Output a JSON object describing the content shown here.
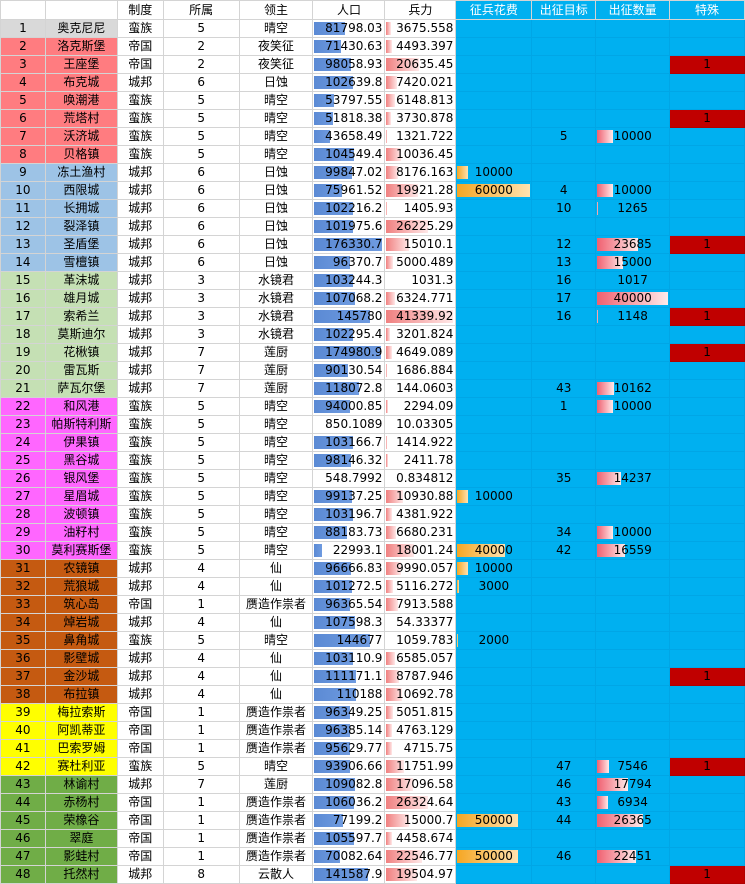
{
  "headers": [
    "",
    "",
    "制度",
    "所属",
    "领主",
    "人口",
    "兵力",
    "征兵花费",
    "出征目标",
    "出征数量",
    "特殊"
  ],
  "colors": {
    "salmon": "#ff7c80",
    "lightblue": "#9dc3e6",
    "lightgreen": "#c5e0b4",
    "magenta": "#ff66ff",
    "orange": "#c55a11",
    "yellow": "#ffff00",
    "green": "#70ad47",
    "gray": "#d9d9d9",
    "blue": "#00b0f0",
    "red": "#c00000"
  },
  "rows": [
    {
      "n": "1",
      "name": "奥克尼尼",
      "sys": "蛮族",
      "belong": "5",
      "lord": "晴空",
      "pop": "81798.03",
      "str": "3675.558",
      "cost": "",
      "target": "",
      "count": "",
      "special": "",
      "grp": "gray"
    },
    {
      "n": "2",
      "name": "洛克斯堡",
      "sys": "帝国",
      "belong": "2",
      "lord": "夜笑征",
      "pop": "71430.63",
      "str": "4493.397",
      "cost": "",
      "target": "",
      "count": "",
      "special": "",
      "grp": "salmon"
    },
    {
      "n": "3",
      "name": "王座堡",
      "sys": "帝国",
      "belong": "2",
      "lord": "夜笑征",
      "pop": "98058.93",
      "str": "20635.45",
      "cost": "",
      "target": "",
      "count": "",
      "special": "1",
      "grp": "salmon"
    },
    {
      "n": "4",
      "name": "布克城",
      "sys": "城邦",
      "belong": "6",
      "lord": "日蚀",
      "pop": "102639.8",
      "str": "7420.021",
      "cost": "",
      "target": "",
      "count": "",
      "special": "",
      "grp": "salmon"
    },
    {
      "n": "5",
      "name": "唤潮港",
      "sys": "蛮族",
      "belong": "5",
      "lord": "晴空",
      "pop": "53797.55",
      "str": "6148.813",
      "cost": "",
      "target": "",
      "count": "",
      "special": "",
      "grp": "salmon"
    },
    {
      "n": "6",
      "name": "荒塔村",
      "sys": "蛮族",
      "belong": "5",
      "lord": "晴空",
      "pop": "51818.38",
      "str": "3730.878",
      "cost": "",
      "target": "",
      "count": "",
      "special": "1",
      "grp": "salmon"
    },
    {
      "n": "7",
      "name": "沃济城",
      "sys": "蛮族",
      "belong": "5",
      "lord": "晴空",
      "pop": "43658.49",
      "str": "1321.722",
      "cost": "",
      "target": "5",
      "count": "10000",
      "special": "",
      "grp": "salmon"
    },
    {
      "n": "8",
      "name": "贝格镇",
      "sys": "蛮族",
      "belong": "5",
      "lord": "晴空",
      "pop": "104549.4",
      "str": "10036.45",
      "cost": "",
      "target": "",
      "count": "",
      "special": "",
      "grp": "salmon"
    },
    {
      "n": "9",
      "name": "冻土渔村",
      "sys": "城邦",
      "belong": "6",
      "lord": "日蚀",
      "pop": "99847.02",
      "str": "8176.163",
      "cost": "10000",
      "target": "",
      "count": "",
      "special": "",
      "grp": "lightblue",
      "sep": true
    },
    {
      "n": "10",
      "name": "西限城",
      "sys": "城邦",
      "belong": "6",
      "lord": "日蚀",
      "pop": "75961.52",
      "str": "19921.28",
      "cost": "60000",
      "target": "4",
      "count": "10000",
      "special": "",
      "grp": "lightblue"
    },
    {
      "n": "11",
      "name": "长拥城",
      "sys": "城邦",
      "belong": "6",
      "lord": "日蚀",
      "pop": "102216.2",
      "str": "1405.93",
      "cost": "",
      "target": "10",
      "count": "1265",
      "special": "",
      "grp": "lightblue"
    },
    {
      "n": "12",
      "name": "裂泽镇",
      "sys": "城邦",
      "belong": "6",
      "lord": "日蚀",
      "pop": "101975.6",
      "str": "26225.29",
      "cost": "",
      "target": "",
      "count": "",
      "special": "",
      "grp": "lightblue"
    },
    {
      "n": "13",
      "name": "圣盾堡",
      "sys": "城邦",
      "belong": "6",
      "lord": "日蚀",
      "pop": "176330.7",
      "str": "15010.1",
      "cost": "",
      "target": "12",
      "count": "23685",
      "special": "1",
      "grp": "lightblue"
    },
    {
      "n": "14",
      "name": "雪檀镇",
      "sys": "城邦",
      "belong": "6",
      "lord": "日蚀",
      "pop": "96370.7",
      "str": "5000.489",
      "cost": "",
      "target": "13",
      "count": "15000",
      "special": "",
      "grp": "lightblue"
    },
    {
      "n": "15",
      "name": "革沫城",
      "sys": "城邦",
      "belong": "3",
      "lord": "水镜君",
      "pop": "103244.3",
      "str": "1031.3",
      "cost": "",
      "target": "16",
      "count": "1017",
      "special": "",
      "grp": "lightgreen",
      "sep": true
    },
    {
      "n": "16",
      "name": "雄月城",
      "sys": "城邦",
      "belong": "3",
      "lord": "水镜君",
      "pop": "107068.2",
      "str": "6324.771",
      "cost": "",
      "target": "17",
      "count": "40000",
      "special": "",
      "grp": "lightgreen"
    },
    {
      "n": "17",
      "name": "索希兰",
      "sys": "城邦",
      "belong": "3",
      "lord": "水镜君",
      "pop": "145780",
      "str": "41339.92",
      "cost": "",
      "target": "16",
      "count": "1148",
      "special": "1",
      "grp": "lightgreen"
    },
    {
      "n": "18",
      "name": "莫斯迪尔",
      "sys": "城邦",
      "belong": "3",
      "lord": "水镜君",
      "pop": "102295.4",
      "str": "3201.824",
      "cost": "",
      "target": "",
      "count": "",
      "special": "",
      "grp": "lightgreen"
    },
    {
      "n": "19",
      "name": "花楸镇",
      "sys": "城邦",
      "belong": "7",
      "lord": "莲厨",
      "pop": "174980.9",
      "str": "4649.089",
      "cost": "",
      "target": "",
      "count": "",
      "special": "1",
      "grp": "lightgreen"
    },
    {
      "n": "20",
      "name": "雷瓦斯",
      "sys": "城邦",
      "belong": "7",
      "lord": "莲厨",
      "pop": "90130.54",
      "str": "1686.884",
      "cost": "",
      "target": "",
      "count": "",
      "special": "",
      "grp": "lightgreen"
    },
    {
      "n": "21",
      "name": "萨瓦尔堡",
      "sys": "城邦",
      "belong": "7",
      "lord": "莲厨",
      "pop": "118072.8",
      "str": "144.0603",
      "cost": "",
      "target": "43",
      "count": "10162",
      "special": "",
      "grp": "lightgreen"
    },
    {
      "n": "22",
      "name": "和风港",
      "sys": "蛮族",
      "belong": "5",
      "lord": "晴空",
      "pop": "94000.85",
      "str": "2294.09",
      "cost": "",
      "target": "1",
      "count": "10000",
      "special": "",
      "grp": "magenta",
      "sep": true
    },
    {
      "n": "23",
      "name": "帕斯特利斯",
      "sys": "蛮族",
      "belong": "5",
      "lord": "晴空",
      "pop": "850.1089",
      "str": "10.03305",
      "cost": "",
      "target": "",
      "count": "",
      "special": "",
      "grp": "magenta"
    },
    {
      "n": "24",
      "name": "伊果镇",
      "sys": "蛮族",
      "belong": "5",
      "lord": "晴空",
      "pop": "103166.7",
      "str": "1414.922",
      "cost": "",
      "target": "",
      "count": "",
      "special": "",
      "grp": "magenta"
    },
    {
      "n": "25",
      "name": "黑谷城",
      "sys": "蛮族",
      "belong": "5",
      "lord": "晴空",
      "pop": "98146.32",
      "str": "2411.78",
      "cost": "",
      "target": "",
      "count": "",
      "special": "",
      "grp": "magenta"
    },
    {
      "n": "26",
      "name": "银风堡",
      "sys": "蛮族",
      "belong": "5",
      "lord": "晴空",
      "pop": "548.7992",
      "str": "0.834812",
      "cost": "",
      "target": "35",
      "count": "14237",
      "special": "",
      "grp": "magenta"
    },
    {
      "n": "27",
      "name": "星眉城",
      "sys": "蛮族",
      "belong": "5",
      "lord": "晴空",
      "pop": "99137.25",
      "str": "10930.88",
      "cost": "10000",
      "target": "",
      "count": "",
      "special": "",
      "grp": "magenta"
    },
    {
      "n": "28",
      "name": "波顿镇",
      "sys": "蛮族",
      "belong": "5",
      "lord": "晴空",
      "pop": "103196.7",
      "str": "4381.922",
      "cost": "",
      "target": "",
      "count": "",
      "special": "",
      "grp": "magenta"
    },
    {
      "n": "29",
      "name": "油籽村",
      "sys": "蛮族",
      "belong": "5",
      "lord": "晴空",
      "pop": "88183.73",
      "str": "6680.231",
      "cost": "",
      "target": "34",
      "count": "10000",
      "special": "",
      "grp": "magenta"
    },
    {
      "n": "30",
      "name": "莫利赛斯堡",
      "sys": "蛮族",
      "belong": "5",
      "lord": "晴空",
      "pop": "22993.1",
      "str": "18001.24",
      "cost": "40000",
      "target": "42",
      "count": "16559",
      "special": "",
      "grp": "magenta"
    },
    {
      "n": "31",
      "name": "农镜镇",
      "sys": "城邦",
      "belong": "4",
      "lord": "仙",
      "pop": "96666.83",
      "str": "9990.057",
      "cost": "10000",
      "target": "",
      "count": "",
      "special": "",
      "grp": "orange",
      "sep": true
    },
    {
      "n": "32",
      "name": "荒狼城",
      "sys": "城邦",
      "belong": "4",
      "lord": "仙",
      "pop": "101272.5",
      "str": "5116.272",
      "cost": "3000",
      "target": "",
      "count": "",
      "special": "",
      "grp": "orange"
    },
    {
      "n": "33",
      "name": "筑心岛",
      "sys": "帝国",
      "belong": "1",
      "lord": "赝造作祟者",
      "pop": "96365.54",
      "str": "7913.588",
      "cost": "",
      "target": "",
      "count": "",
      "special": "",
      "grp": "orange"
    },
    {
      "n": "34",
      "name": "焯岩城",
      "sys": "城邦",
      "belong": "4",
      "lord": "仙",
      "pop": "107598.3",
      "str": "54.33377",
      "cost": "",
      "target": "",
      "count": "",
      "special": "",
      "grp": "orange"
    },
    {
      "n": "35",
      "name": "鼻角城",
      "sys": "蛮族",
      "belong": "5",
      "lord": "晴空",
      "pop": "144677",
      "str": "1059.783",
      "cost": "2000",
      "target": "",
      "count": "",
      "special": "",
      "grp": "orange"
    },
    {
      "n": "36",
      "name": "影壁城",
      "sys": "城邦",
      "belong": "4",
      "lord": "仙",
      "pop": "103110.9",
      "str": "6585.057",
      "cost": "",
      "target": "",
      "count": "",
      "special": "",
      "grp": "orange"
    },
    {
      "n": "37",
      "name": "金沙城",
      "sys": "城邦",
      "belong": "4",
      "lord": "仙",
      "pop": "111171.1",
      "str": "8787.946",
      "cost": "",
      "target": "",
      "count": "",
      "special": "1",
      "grp": "orange"
    },
    {
      "n": "38",
      "name": "布拉镇",
      "sys": "城邦",
      "belong": "4",
      "lord": "仙",
      "pop": "110188",
      "str": "10692.78",
      "cost": "",
      "target": "",
      "count": "",
      "special": "",
      "grp": "orange"
    },
    {
      "n": "39",
      "name": "梅拉索斯",
      "sys": "帝国",
      "belong": "1",
      "lord": "赝造作祟者",
      "pop": "96349.25",
      "str": "5051.815",
      "cost": "",
      "target": "",
      "count": "",
      "special": "",
      "grp": "yellow",
      "sep": true
    },
    {
      "n": "40",
      "name": "阿凯蒂亚",
      "sys": "帝国",
      "belong": "1",
      "lord": "赝造作祟者",
      "pop": "96385.14",
      "str": "4763.129",
      "cost": "",
      "target": "",
      "count": "",
      "special": "",
      "grp": "yellow"
    },
    {
      "n": "41",
      "name": "巴索罗姆",
      "sys": "帝国",
      "belong": "1",
      "lord": "赝造作祟者",
      "pop": "95629.77",
      "str": "4715.75",
      "cost": "",
      "target": "",
      "count": "",
      "special": "",
      "grp": "yellow"
    },
    {
      "n": "42",
      "name": "赛杜利亚",
      "sys": "蛮族",
      "belong": "5",
      "lord": "晴空",
      "pop": "93906.66",
      "str": "11751.99",
      "cost": "",
      "target": "47",
      "count": "7546",
      "special": "1",
      "grp": "yellow"
    },
    {
      "n": "43",
      "name": "林谕村",
      "sys": "城邦",
      "belong": "7",
      "lord": "莲厨",
      "pop": "109082.8",
      "str": "17096.58",
      "cost": "",
      "target": "46",
      "count": "17794",
      "special": "",
      "grp": "green",
      "sep": true
    },
    {
      "n": "44",
      "name": "赤杨村",
      "sys": "帝国",
      "belong": "1",
      "lord": "赝造作祟者",
      "pop": "106036.2",
      "str": "26324.64",
      "cost": "",
      "target": "43",
      "count": "6934",
      "special": "",
      "grp": "green"
    },
    {
      "n": "45",
      "name": "荣橡谷",
      "sys": "帝国",
      "belong": "1",
      "lord": "赝造作祟者",
      "pop": "77199.2",
      "str": "15000.7",
      "cost": "50000",
      "target": "44",
      "count": "26365",
      "special": "",
      "grp": "green"
    },
    {
      "n": "46",
      "name": "翠庭",
      "sys": "帝国",
      "belong": "1",
      "lord": "赝造作祟者",
      "pop": "105597.7",
      "str": "4458.674",
      "cost": "",
      "target": "",
      "count": "",
      "special": "",
      "grp": "green"
    },
    {
      "n": "47",
      "name": "影蛙村",
      "sys": "帝国",
      "belong": "1",
      "lord": "赝造作祟者",
      "pop": "70082.64",
      "str": "22546.77",
      "cost": "50000",
      "target": "46",
      "count": "22451",
      "special": "",
      "grp": "green"
    },
    {
      "n": "48",
      "name": "托然村",
      "sys": "城邦",
      "belong": "8",
      "lord": "云散人",
      "pop": "141587.9",
      "str": "19504.97",
      "cost": "",
      "target": "",
      "count": "",
      "special": "1",
      "grp": "green"
    }
  ],
  "scale": {
    "pop_max": 180000,
    "str_max": 42000,
    "cost_max": 60000,
    "count_max": 40000
  }
}
